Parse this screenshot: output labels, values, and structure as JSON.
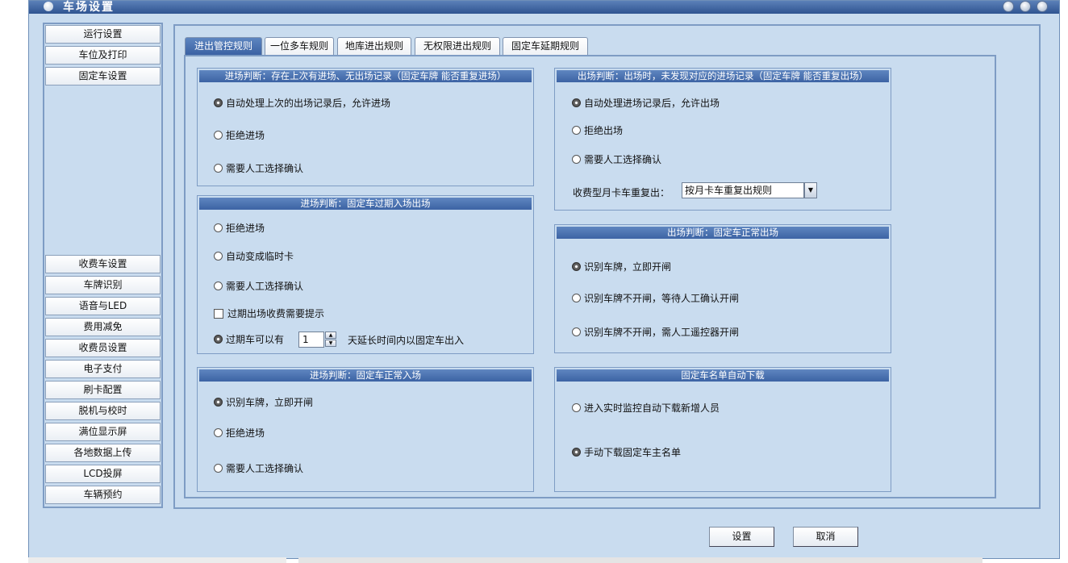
{
  "window": {
    "title": "车场设置"
  },
  "sidebar": {
    "top_items": [
      "运行设置",
      "车位及打印",
      "固定车设置"
    ],
    "bottom_items": [
      "收费车设置",
      "车牌识别",
      "语音与LED",
      "费用减免",
      "收费员设置",
      "电子支付",
      "刷卡配置",
      "脱机与校时",
      "满位显示屏",
      "各地数据上传",
      "LCD投屏",
      "车辆预约"
    ]
  },
  "tabs": [
    "进出管控规则",
    "一位多车规则",
    "地库进出规则",
    "无权限进出规则",
    "固定车延期规则"
  ],
  "active_tab": "进出管控规则",
  "groups": {
    "entry_repeat": {
      "title": "进场判断：存在上次有进场、无出场记录（固定车牌 能否重复进场）",
      "opt1": "自动处理上次的出场记录后，允许进场",
      "opt2": "拒绝进场",
      "opt3": "需要人工选择确认"
    },
    "entry_expired": {
      "title": "进场判断：固定车过期入场出场",
      "opt1": "拒绝进场",
      "opt2": "自动变成临时卡",
      "opt3": "需要人工选择确认",
      "check_label": "过期出场收费需要提示",
      "extend_prefix": "过期车可以有",
      "extend_value": "1",
      "extend_suffix": "天延长时间内以固定车出入"
    },
    "entry_normal": {
      "title": "进场判断：固定车正常入场",
      "opt1": "识别车牌，立即开闸",
      "opt2": "拒绝进场",
      "opt3": "需要人工选择确认"
    },
    "exit_no_entry": {
      "title": "出场判断：出场时，未发现对应的进场记录（固定车牌 能否重复出场）",
      "opt1": "自动处理进场记录后，允许出场",
      "opt2": "拒绝出场",
      "opt3": "需要人工选择确认",
      "select_label": "收费型月卡车重复出：",
      "select_value": "按月卡车重复出规则"
    },
    "exit_normal": {
      "title": "出场判断：固定车正常出场",
      "opt1": "识别车牌，立即开闸",
      "opt2": "识别车牌不开闸，等待人工确认开闸",
      "opt3": "识别车牌不开闸，需人工遥控器开闸"
    },
    "auto_download": {
      "title": "固定车名单自动下载",
      "opt1": "进入实时监控自动下载新增人员",
      "opt2": "手动下载固定车主名单"
    }
  },
  "buttons": {
    "ok": "设置",
    "cancel": "取消"
  }
}
